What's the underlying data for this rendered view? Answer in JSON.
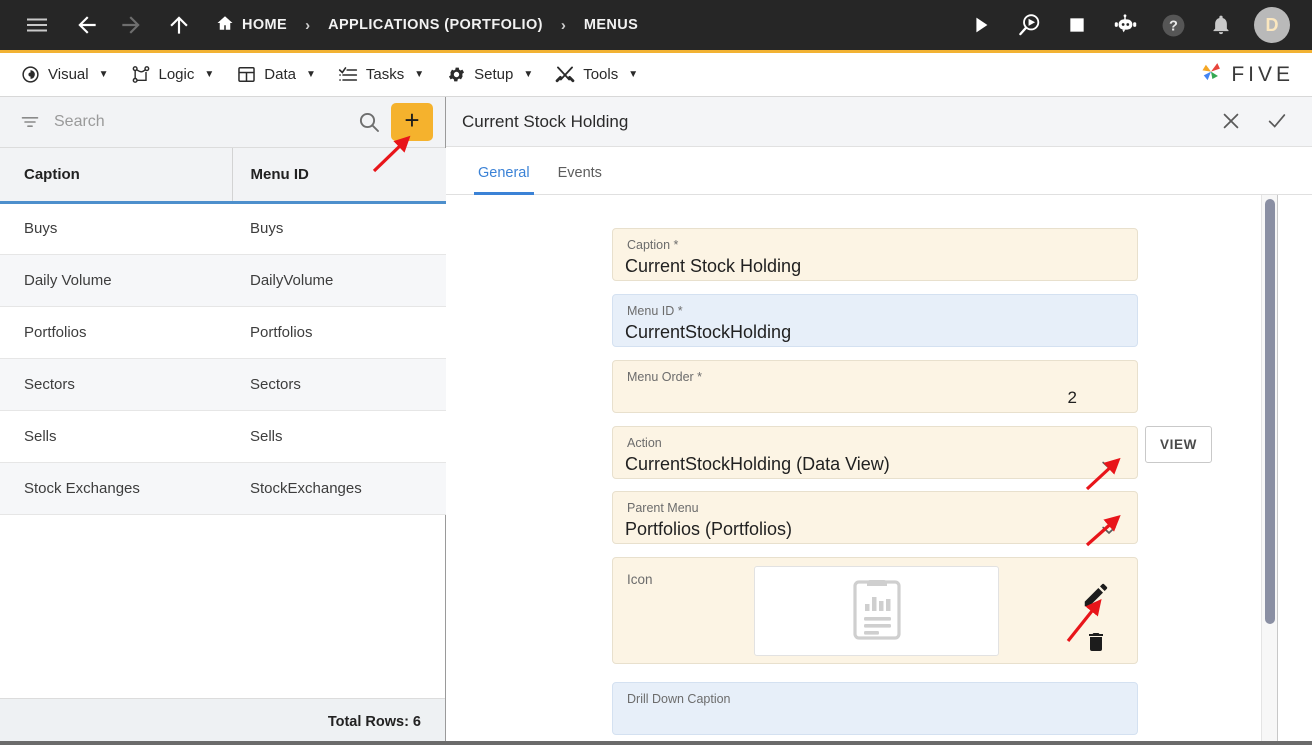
{
  "topbar": {
    "menu_icon": "hamburger-icon",
    "back_icon": "arrow-left-icon",
    "forward_icon": "arrow-right-icon",
    "up_icon": "arrow-up-icon",
    "breadcrumbs": [
      {
        "label": "HOME",
        "icon": "home-icon"
      },
      {
        "label": "APPLICATIONS (PORTFOLIO)",
        "icon": ""
      },
      {
        "label": "MENUS",
        "icon": ""
      }
    ],
    "separator": "›",
    "actions": [
      {
        "name": "run-icon",
        "title": "Run"
      },
      {
        "name": "debug-icon",
        "title": "Debug"
      },
      {
        "name": "stop-icon",
        "title": "Stop"
      },
      {
        "name": "chatbot-icon",
        "title": "Assistant"
      },
      {
        "name": "help-icon",
        "title": "Help"
      },
      {
        "name": "notifications-icon",
        "title": "Notifications"
      }
    ],
    "avatar_initial": "D"
  },
  "menubar": {
    "items": [
      {
        "label": "Visual",
        "icon": "eye-icon"
      },
      {
        "label": "Logic",
        "icon": "nodes-icon"
      },
      {
        "label": "Data",
        "icon": "table-icon"
      },
      {
        "label": "Tasks",
        "icon": "checklist-icon"
      },
      {
        "label": "Setup",
        "icon": "gear-icon"
      },
      {
        "label": "Tools",
        "icon": "tools-icon"
      }
    ],
    "caret": "▼",
    "brand": "FIVE"
  },
  "left_panel": {
    "search": {
      "placeholder": "Search",
      "value": "",
      "filter_icon": "filter-icon",
      "search_icon": "search-icon"
    },
    "add_button_label": "+",
    "columns": [
      "Caption",
      "Menu ID"
    ],
    "rows": [
      {
        "caption": "Buys",
        "menu_id": "Buys"
      },
      {
        "caption": "Daily Volume",
        "menu_id": "DailyVolume"
      },
      {
        "caption": "Portfolios",
        "menu_id": "Portfolios"
      },
      {
        "caption": "Sectors",
        "menu_id": "Sectors"
      },
      {
        "caption": "Sells",
        "menu_id": "Sells"
      },
      {
        "caption": "Stock Exchanges",
        "menu_id": "StockExchanges"
      }
    ],
    "footer": "Total Rows: 6"
  },
  "right_panel": {
    "title": "Current Stock Holding",
    "close_icon": "close-icon",
    "confirm_icon": "check-icon",
    "tabs": [
      {
        "label": "General",
        "active": true
      },
      {
        "label": "Events",
        "active": false
      }
    ],
    "fields": {
      "caption": {
        "label": "Caption *",
        "value": "Current Stock Holding"
      },
      "menu_id": {
        "label": "Menu ID *",
        "value": "CurrentStockHolding"
      },
      "menu_order": {
        "label": "Menu Order *",
        "value": "2"
      },
      "action": {
        "label": "Action",
        "value": "CurrentStockHolding (Data View)",
        "button_label": "VIEW"
      },
      "parent_menu": {
        "label": "Parent Menu",
        "value": "Portfolios (Portfolios)"
      },
      "icon": {
        "label": "Icon",
        "preview_icon": "report-clipboard-icon",
        "edit_icon": "pencil-icon",
        "delete_icon": "trash-icon"
      },
      "drill_down_caption": {
        "label": "Drill Down Caption",
        "value": ""
      }
    }
  },
  "colors": {
    "accent_yellow": "#f5b22d",
    "accent_blue": "#3b82d6",
    "topbar_bg": "#262626",
    "field_cream": "#fcf4e4",
    "field_blue": "#e7eff9",
    "annotation_red": "#e8151a"
  }
}
